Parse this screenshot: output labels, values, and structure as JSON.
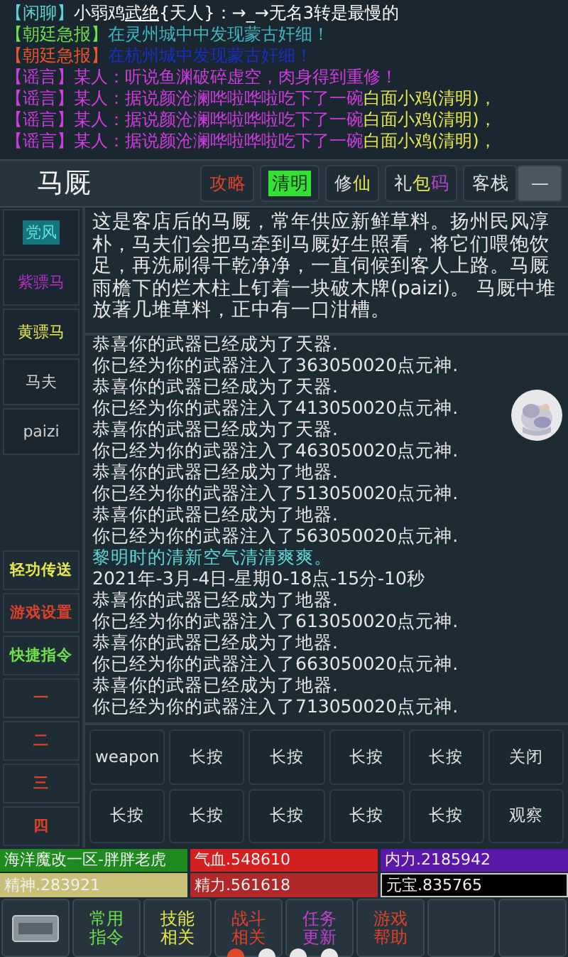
{
  "chat": [
    {
      "tag": "【闲聊】",
      "color": "#5fd3d3",
      "segments": [
        {
          "text": "小弱鸡 ",
          "color": "#ffffff",
          "underline": false
        },
        {
          "text": "武绝",
          "color": "#ffffff",
          "underline": true
        },
        {
          "text": "{天人}：→_→无名3转是最慢的",
          "color": "#ffffff",
          "underline": false
        }
      ]
    },
    {
      "tag": "【朝廷急报】",
      "color": "#6fe04a",
      "segments": [
        {
          "text": "在灵州城中中发现蒙古奸细！",
          "color": "#3fb7c0",
          "underline": false
        }
      ]
    },
    {
      "tag": "【朝廷急报】",
      "color": "#f0552a",
      "segments": [
        {
          "text": "在杭州城中发现蒙古奸细！",
          "color": "#1a2fc8",
          "underline": false
        }
      ]
    },
    {
      "tag": "【谣言】",
      "color": "#d23be0",
      "segments": [
        {
          "text": "某人：听说鱼渊破碎虚空，肉身得到重修！",
          "color": "#d23be0",
          "underline": false
        }
      ]
    },
    {
      "tag": "【谣言】",
      "color": "#d23be0",
      "segments": [
        {
          "text": "某人：据说颜沧澜哗啦哗啦吃下了一碗",
          "color": "#d23be0",
          "underline": false
        },
        {
          "text": "白面小鸡(清明)，",
          "color": "#e8e84a",
          "underline": false
        }
      ]
    },
    {
      "tag": "【谣言】",
      "color": "#d23be0",
      "segments": [
        {
          "text": "某人：据说颜沧澜哗啦哗啦吃下了一碗",
          "color": "#d23be0",
          "underline": false
        },
        {
          "text": "白面小鸡(清明)，",
          "color": "#e8e84a",
          "underline": false
        }
      ]
    },
    {
      "tag": "【谣言】",
      "color": "#d23be0",
      "segments": [
        {
          "text": "某人：据说颜沧澜哗啦哗啦吃下了一碗",
          "color": "#d23be0",
          "underline": false
        },
        {
          "text": "白面小鸡(清明)，",
          "color": "#e8e84a",
          "underline": false
        }
      ]
    }
  ],
  "header": {
    "title": "马厩",
    "buttons": [
      {
        "kind": "text",
        "segments": [
          {
            "text": "攻略",
            "color": "#e0402a"
          }
        ]
      },
      {
        "kind": "highlight",
        "segments": [
          {
            "text": "清明",
            "color": "#0a2a0a"
          }
        ]
      },
      {
        "kind": "text",
        "segments": [
          {
            "text": "修",
            "color": "#e0e0e0"
          },
          {
            "text": "仙",
            "color": "#e8e84a"
          }
        ]
      },
      {
        "kind": "text",
        "segments": [
          {
            "text": "礼",
            "color": "#e0e0e0"
          },
          {
            "text": "包",
            "color": "#e8e84a"
          },
          {
            "text": "码",
            "color": "#c040d0"
          }
        ]
      },
      {
        "kind": "text",
        "segments": [
          {
            "text": "客栈",
            "color": "#e0e0e0"
          }
        ]
      },
      {
        "kind": "minimize",
        "segments": [
          {
            "text": "—",
            "color": "#e0e0e0"
          }
        ]
      }
    ]
  },
  "sidebar": {
    "items": [
      {
        "label": "党风",
        "color": "#5fe0e0",
        "selected": true
      },
      {
        "label": "紫骠马",
        "color": "#b030c0",
        "selected": false
      },
      {
        "label": "黄骠马",
        "color": "#e8e84a",
        "selected": false
      },
      {
        "label": "马夫",
        "color": "#d0d0d0",
        "selected": false
      },
      {
        "label": "paizi",
        "color": "#d0d0d0",
        "selected": false
      }
    ]
  },
  "menu": [
    {
      "label": "轻功传送",
      "color": "#e8e84a"
    },
    {
      "label": "游戏设置",
      "color": "#e0402a"
    },
    {
      "label": "快捷指令",
      "color": "#6fe04a"
    },
    {
      "label": "一",
      "color": "#e0402a"
    },
    {
      "label": "二",
      "color": "#e0402a"
    },
    {
      "label": "三",
      "color": "#e0402a"
    },
    {
      "label": "四",
      "color": "#e0402a"
    }
  ],
  "description": "这是客店后的马厩，常年供应新鲜草料。扬州民风淳朴，马夫们会把马牵到马厩好生照看，将它们喂饱饮足，再洗刷得干乾净净，一直伺候到客人上路。马厩雨檐下的烂木柱上钉着一块破木牌(paizi)。 马厩中堆放著几堆草料，正中有一口泔槽。",
  "log": [
    {
      "text": "恭喜你的武器已经成为了天器.",
      "kind": "normal"
    },
    {
      "text": "你已经为你的武器注入了363050020点元神.",
      "kind": "normal"
    },
    {
      "text": "恭喜你的武器已经成为了天器.",
      "kind": "normal"
    },
    {
      "text": "你已经为你的武器注入了413050020点元神.",
      "kind": "normal"
    },
    {
      "text": "恭喜你的武器已经成为了天器.",
      "kind": "normal"
    },
    {
      "text": "你已经为你的武器注入了463050020点元神.",
      "kind": "normal"
    },
    {
      "text": "恭喜你的武器已经成为了地器.",
      "kind": "normal"
    },
    {
      "text": "你已经为你的武器注入了513050020点元神.",
      "kind": "normal"
    },
    {
      "text": "恭喜你的武器已经成为了地器.",
      "kind": "normal"
    },
    {
      "text": "你已经为你的武器注入了563050020点元神.",
      "kind": "normal"
    },
    {
      "text": "黎明时的清新空气清清爽爽。",
      "kind": "weather"
    },
    {
      "text": "2021年-3月-4日-星期0-18点-15分-10秒",
      "kind": "normal"
    },
    {
      "text": "恭喜你的武器已经成为了地器.",
      "kind": "normal"
    },
    {
      "text": "你已经为你的武器注入了613050020点元神.",
      "kind": "normal"
    },
    {
      "text": "恭喜你的武器已经成为了地器.",
      "kind": "normal"
    },
    {
      "text": "你已经为你的武器注入了663050020点元神.",
      "kind": "normal"
    },
    {
      "text": "恭喜你的武器已经成为了地器.",
      "kind": "normal"
    },
    {
      "text": "你已经为你的武器注入了713050020点元神.",
      "kind": "normal"
    }
  ],
  "shortcuts": [
    "weapon",
    "长按",
    "长按",
    "长按",
    "长按",
    "关闭",
    "长按",
    "长按",
    "长按",
    "长按",
    "长按",
    "观察"
  ],
  "stats": [
    {
      "text": "海洋魔改一区-胖胖老虎",
      "color": "#1f8a1f"
    },
    {
      "text": "气血.548610",
      "color": "#d42020"
    },
    {
      "text": "内力.2185942",
      "color": "#5a18a8"
    },
    {
      "text": "精神.283921",
      "color": "#c8c078"
    },
    {
      "text": "精力.561618",
      "color": "#b02828"
    },
    {
      "text": "元宝.835765",
      "color": "#000000"
    }
  ],
  "bottom_bar": [
    {
      "kind": "input"
    },
    {
      "kind": "text",
      "label": "常用指令",
      "color": "#6fe04a"
    },
    {
      "kind": "text",
      "label": "技能相关",
      "color": "#e8e84a"
    },
    {
      "kind": "text",
      "label": "战斗相关",
      "color": "#e0402a"
    },
    {
      "kind": "text",
      "label": "任务更新",
      "color": "#c040d0"
    },
    {
      "kind": "text",
      "label": "游戏帮助",
      "color": "#e0402a"
    },
    {
      "kind": "blank"
    },
    {
      "kind": "blank"
    }
  ],
  "pages": [
    {
      "selected": true
    },
    {
      "selected": false
    },
    {
      "selected": false
    },
    {
      "selected": false
    }
  ]
}
